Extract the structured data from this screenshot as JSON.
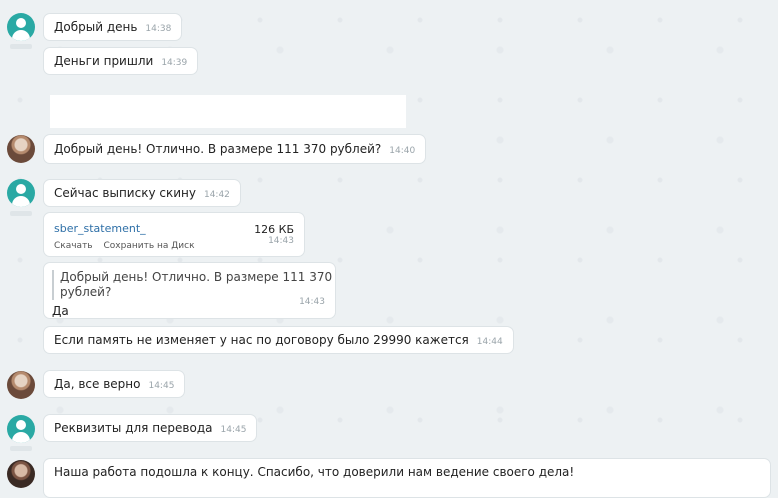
{
  "messages": [
    {
      "text": "Добрый день",
      "time": "14:38"
    },
    {
      "text": "Деньги пришли",
      "time": "14:39"
    },
    {
      "text": "Добрый день! Отлично. В размере 111 370 рублей?",
      "time": "14:40"
    },
    {
      "text": "Сейчас выписку скину",
      "time": "14:42"
    },
    {
      "file": {
        "name": "sber_statement_",
        "size": "126 КБ",
        "download_label": "Скачать",
        "save_label": "Сохранить на Диск",
        "time": "14:43"
      }
    },
    {
      "quote": "Добрый день! Отлично. В размере 111 370 рублей?",
      "text": "Да",
      "time": "14:43"
    },
    {
      "text": "Если память не изменяет у нас по договору было 29990 кажется",
      "time": "14:44"
    },
    {
      "text": "Да, все верно",
      "time": "14:45"
    },
    {
      "text": "Реквизиты для перевода",
      "time": "14:45"
    },
    {
      "text": "Наша работа подошла к концу. Спасибо, что доверили нам ведение своего дела!"
    }
  ],
  "colors": {
    "background": "#edf1f3",
    "bubble": "#ffffff",
    "avatar_teal": "#2aa9a4",
    "file_link": "#2e6fa7",
    "timestamp": "#9aa4aa"
  },
  "icons": [
    "user-avatar-icon",
    "contact-photo-avatar"
  ]
}
